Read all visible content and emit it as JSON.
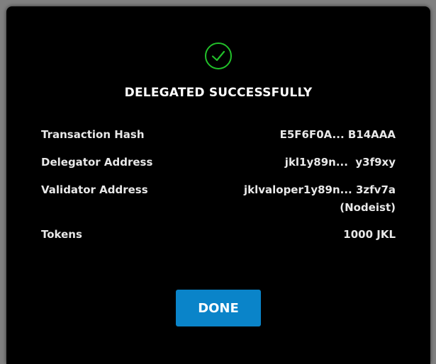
{
  "dialog": {
    "title": "DELEGATED SUCCESSFULLY",
    "status_icon": "check-circle-icon",
    "accent_color": "#22c02a",
    "rows": [
      {
        "label": "Transaction Hash",
        "value": "E5F6F0A... B14AAA"
      },
      {
        "label": "Delegator Address",
        "value": "jkl1y89n...  y3f9xy"
      },
      {
        "label": "Validator Address",
        "value": "jklvaloper1y89n... 3zfv7a",
        "value_note": "(Nodeist)"
      },
      {
        "label": "Tokens",
        "value": "1000 JKL"
      }
    ],
    "done_label": "DONE",
    "button_color": "#0a84c9"
  }
}
